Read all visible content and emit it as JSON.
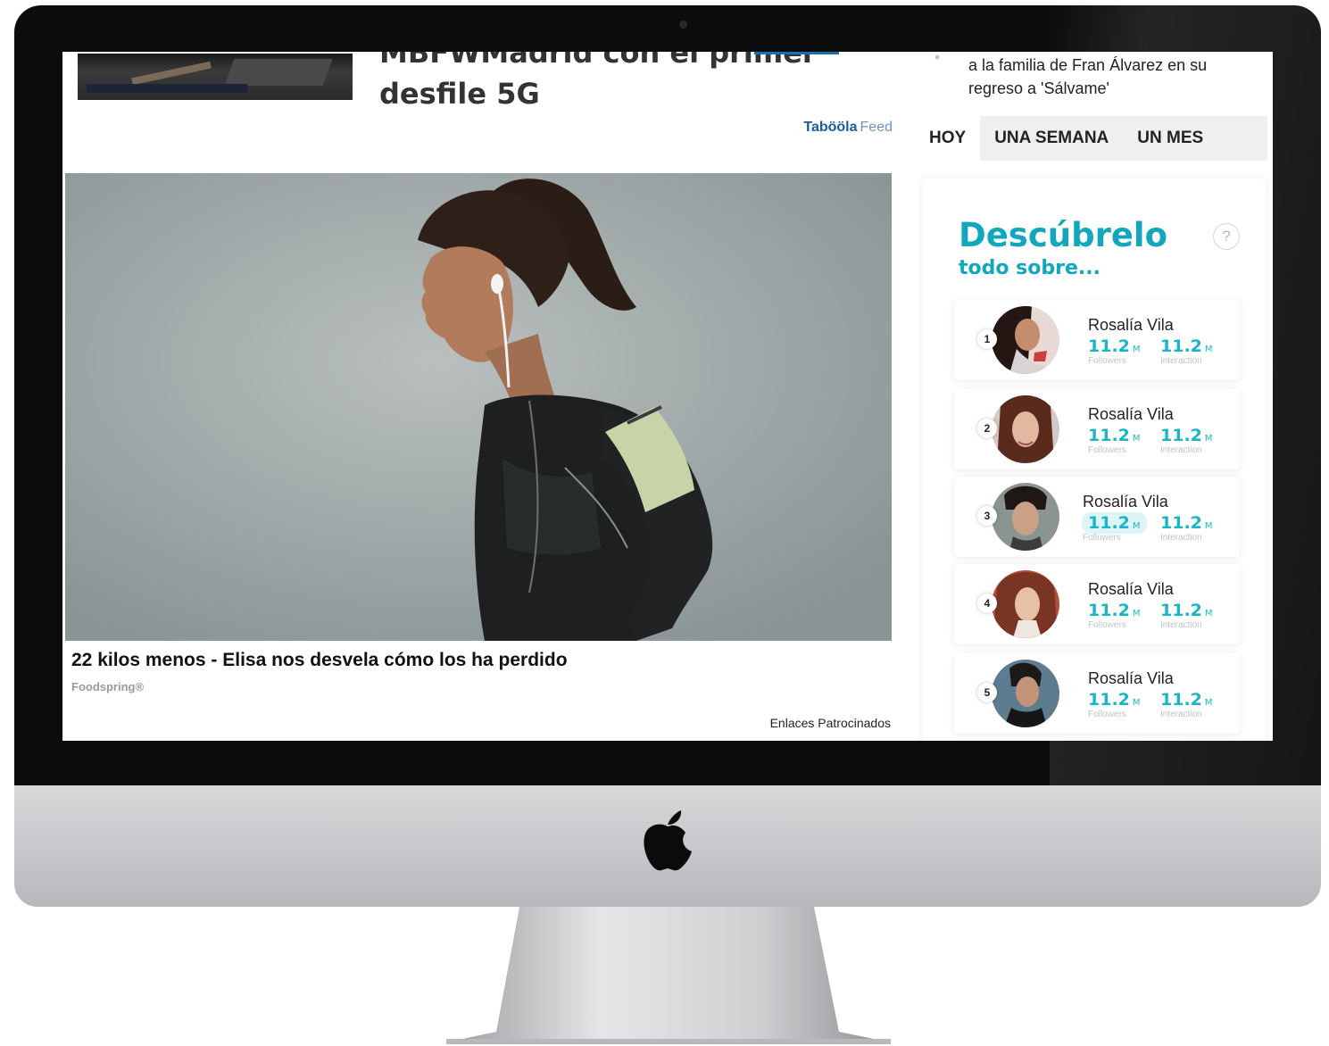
{
  "article": {
    "headline_partial": "MBFWMadrid con el primer",
    "headline_line2": "desfile 5G",
    "feed_brand": "Tabööla",
    "feed_label": "Feed",
    "caption_title": "22 kilos menos - Elisa nos desvela cómo los ha perdido",
    "caption_source": "Foodspring®",
    "sponsored_label": "Enlaces Patrocinados"
  },
  "sidebar": {
    "news_snippet": "a la familia de Fran Álvarez en su regreso a 'Sálvame'",
    "tabs": [
      {
        "label": "HOY",
        "active": true
      },
      {
        "label": "UNA SEMANA",
        "active": false
      },
      {
        "label": "UN MES",
        "active": false
      }
    ],
    "discover": {
      "title": "Descúbrelo",
      "subtitle": "todo sobre...",
      "help": "?"
    },
    "ranking": [
      {
        "rank": "1",
        "name": "Rosalía Vila",
        "followers": "11.2",
        "followers_unit": "M",
        "followers_label": "Followers",
        "interaction": "11.2",
        "interaction_unit": "M",
        "interaction_label": "Interaction"
      },
      {
        "rank": "2",
        "name": "Rosalía Vila",
        "followers": "11.2",
        "followers_unit": "M",
        "followers_label": "Followers",
        "interaction": "11.2",
        "interaction_unit": "M",
        "interaction_label": "Interaction"
      },
      {
        "rank": "3",
        "name": "Rosalía Vila",
        "followers": "11.2",
        "followers_unit": "M",
        "followers_label": "Followers",
        "interaction": "11.2",
        "interaction_unit": "M",
        "interaction_label": "Interaction"
      },
      {
        "rank": "4",
        "name": "Rosalía Vila",
        "followers": "11.2",
        "followers_unit": "M",
        "followers_label": "Followers",
        "interaction": "11.2",
        "interaction_unit": "M",
        "interaction_label": "Interaction"
      },
      {
        "rank": "5",
        "name": "Rosalía Vila",
        "followers": "11.2",
        "followers_unit": "M",
        "followers_label": "Followers",
        "interaction": "11.2",
        "interaction_unit": "M",
        "interaction_label": "Interaction"
      }
    ]
  },
  "colors": {
    "accent": "#12a7bd",
    "stat": "#1ab5c9",
    "feed_brand": "#1c5c9a"
  },
  "icons": {
    "device_logo": "apple-logo-icon",
    "help": "question-mark-icon"
  }
}
